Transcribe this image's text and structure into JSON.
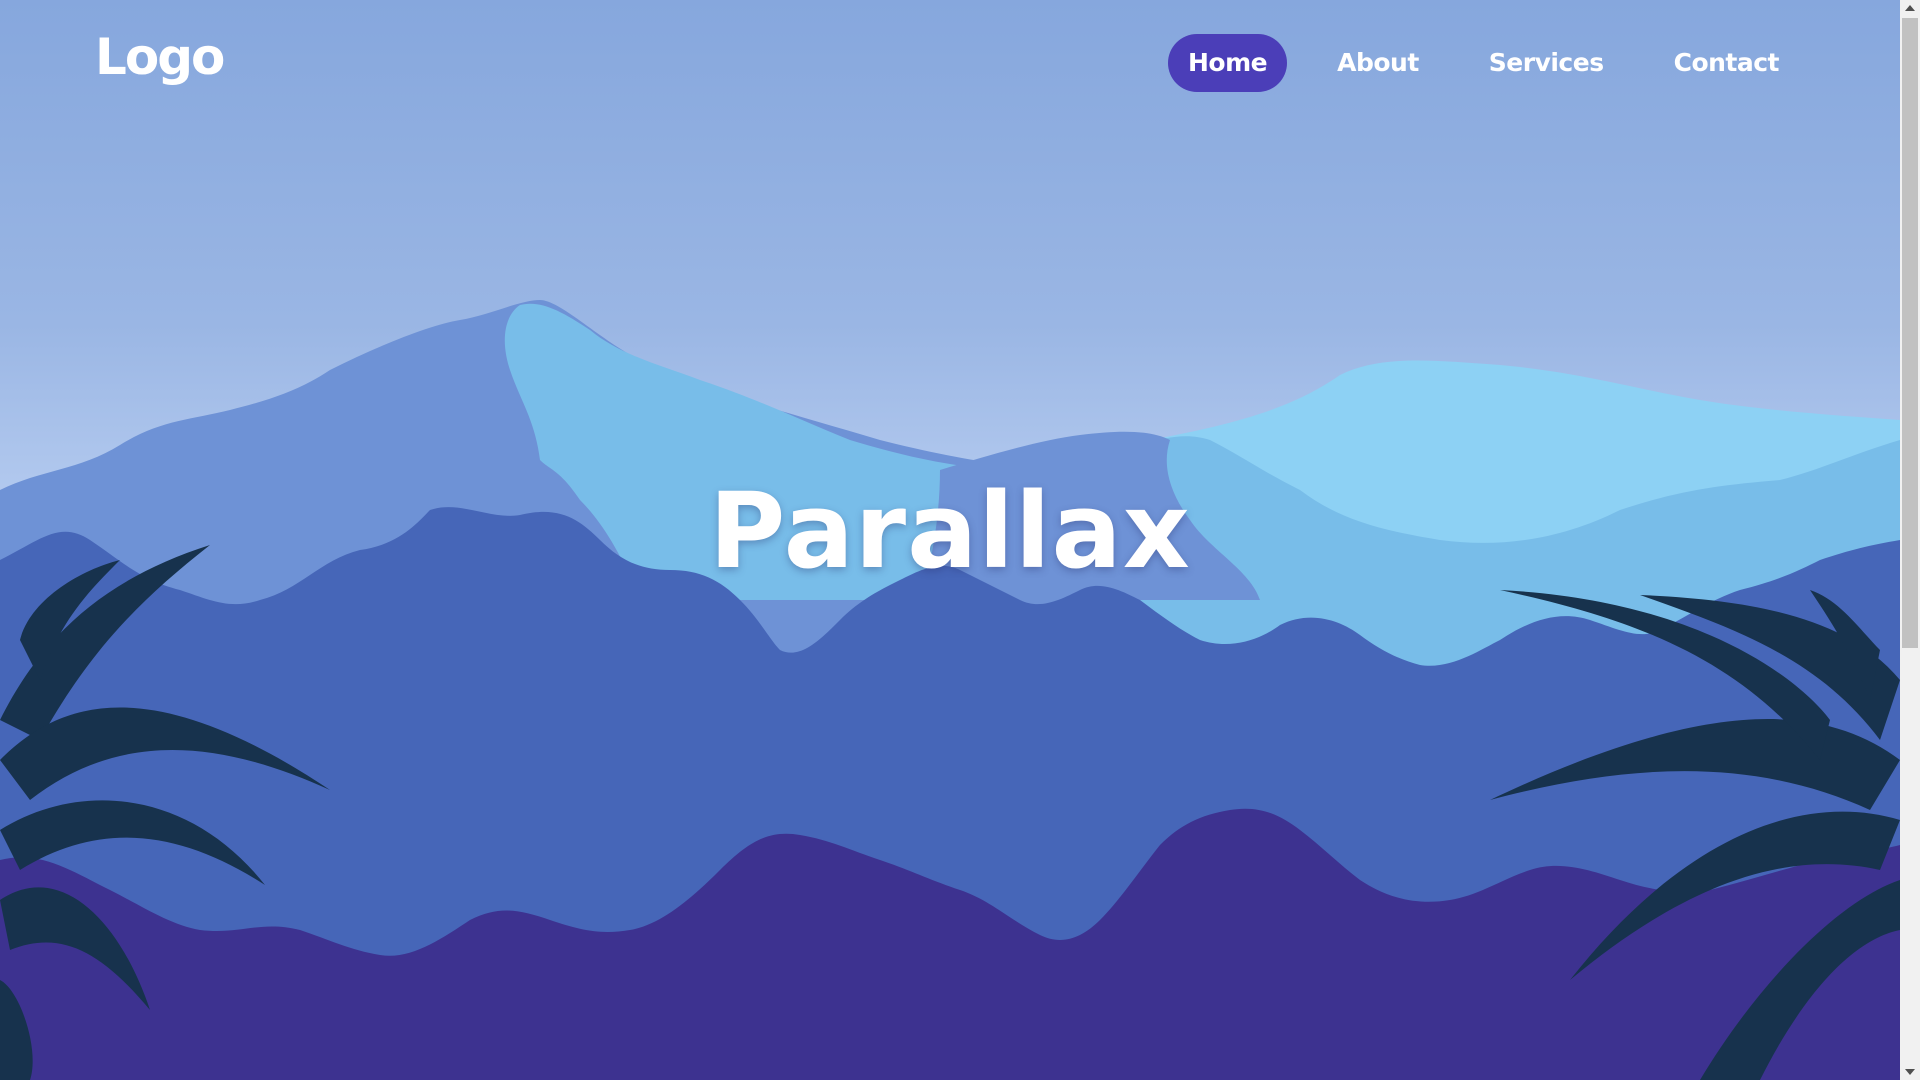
{
  "header": {
    "logo": "Logo",
    "nav": [
      {
        "label": "Home",
        "active": true
      },
      {
        "label": "About",
        "active": false
      },
      {
        "label": "Services",
        "active": false
      },
      {
        "label": "Contact",
        "active": false
      }
    ]
  },
  "hero": {
    "title": "Parallax"
  },
  "colors": {
    "accent": "#4b3eb8",
    "sky_top": "#86a7dd",
    "mountain_dark": "#6e92d6",
    "mountain_light": "#8dd1f4",
    "bush_mid": "#4666b8",
    "bush_front": "#3d3290",
    "leaves": "#17324d"
  }
}
